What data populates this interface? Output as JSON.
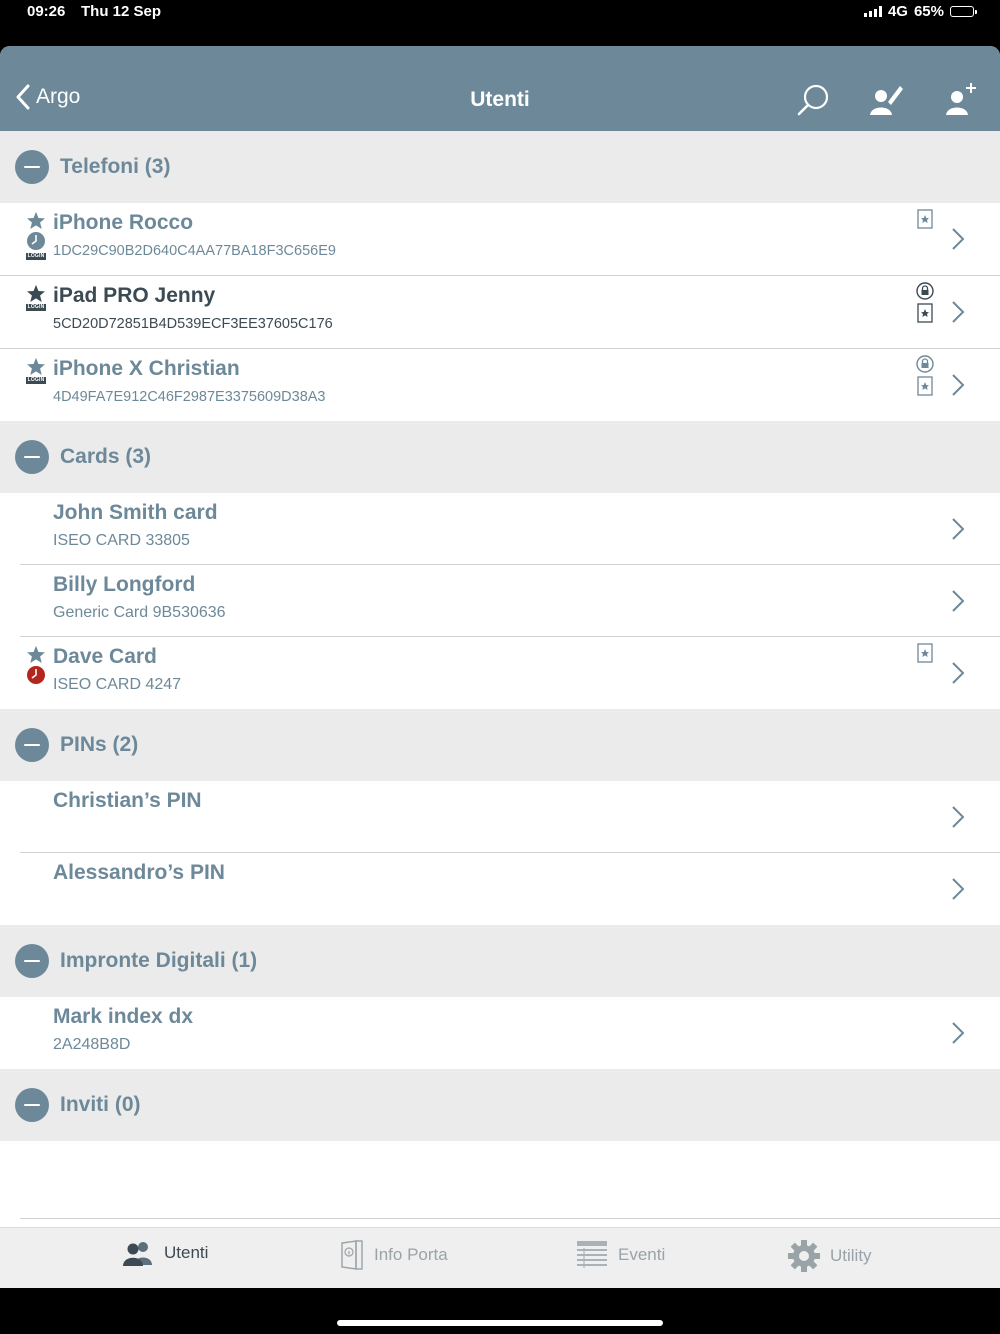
{
  "status_bar": {
    "time": "09:26",
    "date": "Thu 12 Sep",
    "network": "4G",
    "battery": "65%",
    "battery_level": 0.65
  },
  "navbar": {
    "back_label": "Argo",
    "title": "Utenti"
  },
  "sections": {
    "telefoni": {
      "title": "Telefoni (3)",
      "items": [
        {
          "name": "iPhone Rocco",
          "sub": "1DC29C90B2D640C4AA77BA18F3C656E9"
        },
        {
          "name": "iPad PRO Jenny",
          "sub": "5CD20D72851B4D539ECF3EE37605C176"
        },
        {
          "name": "iPhone X Christian",
          "sub": "4D49FA7E912C46F2987E3375609D38A3"
        }
      ]
    },
    "cards": {
      "title": "Cards (3)",
      "items": [
        {
          "name": "John Smith card",
          "sub": "ISEO CARD 33805"
        },
        {
          "name": "Billy Longford",
          "sub": "Generic Card 9B530636"
        },
        {
          "name": "Dave Card",
          "sub": "ISEO CARD 4247"
        }
      ]
    },
    "pins": {
      "title": "PINs (2)",
      "items": [
        {
          "name": "Christian’s PIN"
        },
        {
          "name": "Alessandro’s PIN"
        }
      ]
    },
    "impronte": {
      "title": "Impronte Digitali (1)",
      "items": [
        {
          "name": "Mark index dx",
          "sub": "2A248B8D"
        }
      ]
    },
    "inviti": {
      "title": "Inviti (0)"
    }
  },
  "badge": {
    "login": "LOGIN"
  },
  "tabs": {
    "utenti": "Utenti",
    "info_porta": "Info Porta",
    "eventi": "Eventi",
    "utility": "Utility"
  },
  "colors": {
    "accent": "#6d8999",
    "dark": "#3c4a53",
    "alert": "#b3261e"
  }
}
